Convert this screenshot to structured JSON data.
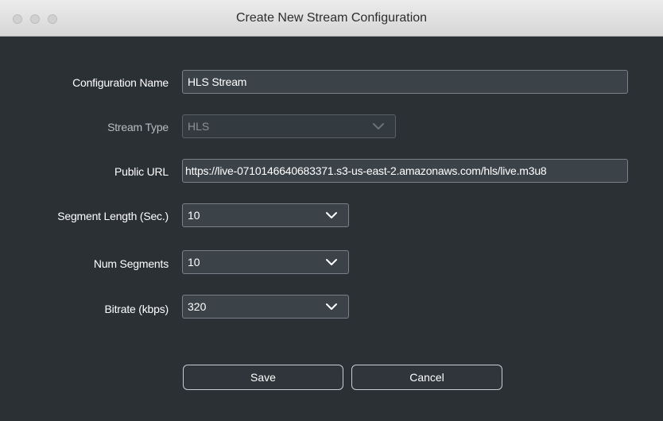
{
  "window": {
    "title": "Create New Stream Configuration"
  },
  "form": {
    "config_name": {
      "label": "Configuration Name",
      "value": "HLS Stream"
    },
    "stream_type": {
      "label": "Stream Type",
      "value": "HLS"
    },
    "public_url": {
      "label": "Public URL",
      "value": "https://live-0710146640683371.s3-us-east-2.amazonaws.com/hls/live.m3u8"
    },
    "segment_length": {
      "label": "Segment Length (Sec.)",
      "value": "10"
    },
    "num_segments": {
      "label": "Num Segments",
      "value": "10"
    },
    "bitrate": {
      "label": "Bitrate (kbps)",
      "value": "320"
    }
  },
  "buttons": {
    "save": "Save",
    "cancel": "Cancel"
  },
  "colors": {
    "background": "#2b3035",
    "field_bg": "#3b4248",
    "field_border": "#79808a",
    "titlebar": "#e4e4e4"
  },
  "icons": {
    "dropdown": "chevron-down-icon"
  }
}
